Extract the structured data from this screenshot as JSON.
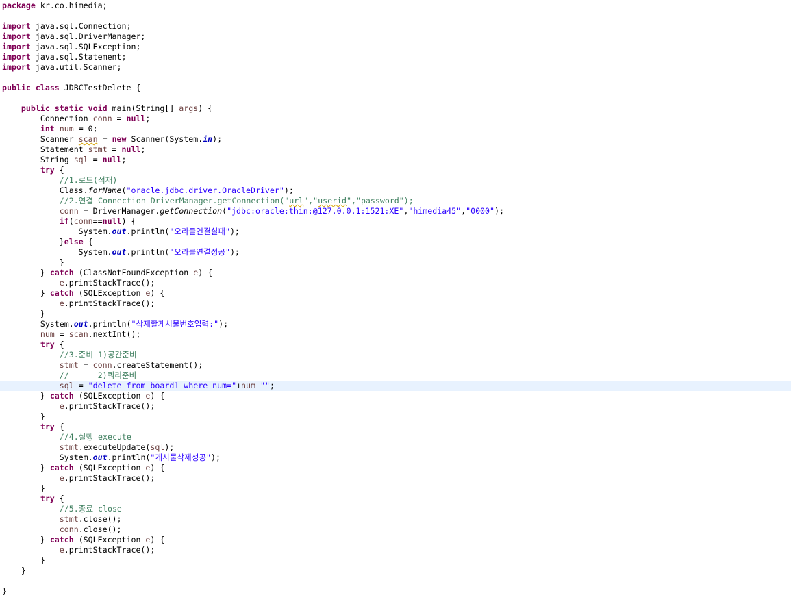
{
  "editor": {
    "language": "java",
    "current_line_index": 37,
    "colors": {
      "keyword": "#7f0055",
      "string": "#2a00ff",
      "comment": "#3f7f5f",
      "local_variable": "#6a3e3e",
      "static_field": "#0000c0",
      "current_line_bg": "#e8f2fe",
      "warning_underline": "#d6a200"
    },
    "lines": [
      [
        {
          "t": "kw",
          "v": "package"
        },
        {
          "t": "p",
          "v": " kr.co.himedia;"
        }
      ],
      [],
      [
        {
          "t": "kw",
          "v": "import"
        },
        {
          "t": "p",
          "v": " java.sql.Connection;"
        }
      ],
      [
        {
          "t": "kw",
          "v": "import"
        },
        {
          "t": "p",
          "v": " java.sql.DriverManager;"
        }
      ],
      [
        {
          "t": "kw",
          "v": "import"
        },
        {
          "t": "p",
          "v": " java.sql.SQLException;"
        }
      ],
      [
        {
          "t": "kw",
          "v": "import"
        },
        {
          "t": "p",
          "v": " java.sql.Statement;"
        }
      ],
      [
        {
          "t": "kw",
          "v": "import"
        },
        {
          "t": "p",
          "v": " java.util.Scanner;"
        }
      ],
      [],
      [
        {
          "t": "kw",
          "v": "public"
        },
        {
          "t": "p",
          "v": " "
        },
        {
          "t": "kw",
          "v": "class"
        },
        {
          "t": "p",
          "v": " JDBCTestDelete {"
        }
      ],
      [],
      [
        {
          "t": "p",
          "v": "    "
        },
        {
          "t": "kw",
          "v": "public"
        },
        {
          "t": "p",
          "v": " "
        },
        {
          "t": "kw",
          "v": "static"
        },
        {
          "t": "p",
          "v": " "
        },
        {
          "t": "kw",
          "v": "void"
        },
        {
          "t": "p",
          "v": " main(String[] "
        },
        {
          "t": "var",
          "v": "args"
        },
        {
          "t": "p",
          "v": ") {"
        }
      ],
      [
        {
          "t": "p",
          "v": "        Connection "
        },
        {
          "t": "var",
          "v": "conn"
        },
        {
          "t": "p",
          "v": " = "
        },
        {
          "t": "kw",
          "v": "null"
        },
        {
          "t": "p",
          "v": ";"
        }
      ],
      [
        {
          "t": "p",
          "v": "        "
        },
        {
          "t": "kw",
          "v": "int"
        },
        {
          "t": "p",
          "v": " "
        },
        {
          "t": "var",
          "v": "num"
        },
        {
          "t": "p",
          "v": " = 0;"
        }
      ],
      [
        {
          "t": "p",
          "v": "        Scanner "
        },
        {
          "t": "varw",
          "v": "scan"
        },
        {
          "t": "p",
          "v": " = "
        },
        {
          "t": "kw",
          "v": "new"
        },
        {
          "t": "p",
          "v": " Scanner(System."
        },
        {
          "t": "static",
          "v": "in"
        },
        {
          "t": "p",
          "v": ");"
        }
      ],
      [
        {
          "t": "p",
          "v": "        Statement "
        },
        {
          "t": "var",
          "v": "stmt"
        },
        {
          "t": "p",
          "v": " = "
        },
        {
          "t": "kw",
          "v": "null"
        },
        {
          "t": "p",
          "v": ";"
        }
      ],
      [
        {
          "t": "p",
          "v": "        String "
        },
        {
          "t": "var",
          "v": "sql"
        },
        {
          "t": "p",
          "v": " = "
        },
        {
          "t": "kw",
          "v": "null"
        },
        {
          "t": "p",
          "v": ";"
        }
      ],
      [
        {
          "t": "p",
          "v": "        "
        },
        {
          "t": "kw",
          "v": "try"
        },
        {
          "t": "p",
          "v": " {"
        }
      ],
      [
        {
          "t": "p",
          "v": "            "
        },
        {
          "t": "com",
          "v": "//1.로드(적재)"
        }
      ],
      [
        {
          "t": "p",
          "v": "            Class."
        },
        {
          "t": "smeth",
          "v": "forName"
        },
        {
          "t": "p",
          "v": "("
        },
        {
          "t": "str",
          "v": "\"oracle.jdbc.driver.OracleDriver\""
        },
        {
          "t": "p",
          "v": ");"
        }
      ],
      [
        {
          "t": "p",
          "v": "            "
        },
        {
          "t": "com",
          "v": "//2.연결 Connection DriverManager.getConnection(\""
        },
        {
          "t": "comw",
          "v": "url"
        },
        {
          "t": "com",
          "v": "\",\""
        },
        {
          "t": "comw",
          "v": "userid"
        },
        {
          "t": "com",
          "v": "\",\"password\");"
        }
      ],
      [
        {
          "t": "p",
          "v": "            "
        },
        {
          "t": "var",
          "v": "conn"
        },
        {
          "t": "p",
          "v": " = DriverManager."
        },
        {
          "t": "smeth",
          "v": "getConnection"
        },
        {
          "t": "p",
          "v": "("
        },
        {
          "t": "str",
          "v": "\"jdbc:oracle:thin:@127.0.0.1:1521:XE\""
        },
        {
          "t": "p",
          "v": ","
        },
        {
          "t": "str",
          "v": "\"himedia45\""
        },
        {
          "t": "p",
          "v": ","
        },
        {
          "t": "str",
          "v": "\"0000\""
        },
        {
          "t": "p",
          "v": ");"
        }
      ],
      [
        {
          "t": "p",
          "v": "            "
        },
        {
          "t": "kw",
          "v": "if"
        },
        {
          "t": "p",
          "v": "("
        },
        {
          "t": "var",
          "v": "conn"
        },
        {
          "t": "p",
          "v": "=="
        },
        {
          "t": "kw",
          "v": "null"
        },
        {
          "t": "p",
          "v": ") {"
        }
      ],
      [
        {
          "t": "p",
          "v": "                System."
        },
        {
          "t": "static",
          "v": "out"
        },
        {
          "t": "p",
          "v": ".println("
        },
        {
          "t": "str",
          "v": "\"오라클연결실패\""
        },
        {
          "t": "p",
          "v": ");"
        }
      ],
      [
        {
          "t": "p",
          "v": "            }"
        },
        {
          "t": "kw",
          "v": "else"
        },
        {
          "t": "p",
          "v": " {"
        }
      ],
      [
        {
          "t": "p",
          "v": "                System."
        },
        {
          "t": "static",
          "v": "out"
        },
        {
          "t": "p",
          "v": ".println("
        },
        {
          "t": "str",
          "v": "\"오라클연결성공\""
        },
        {
          "t": "p",
          "v": ");"
        }
      ],
      [
        {
          "t": "p",
          "v": "            }"
        }
      ],
      [
        {
          "t": "p",
          "v": "        } "
        },
        {
          "t": "kw",
          "v": "catch"
        },
        {
          "t": "p",
          "v": " (ClassNotFoundException "
        },
        {
          "t": "var",
          "v": "e"
        },
        {
          "t": "p",
          "v": ") {"
        }
      ],
      [
        {
          "t": "p",
          "v": "            "
        },
        {
          "t": "var",
          "v": "e"
        },
        {
          "t": "p",
          "v": ".printStackTrace();"
        }
      ],
      [
        {
          "t": "p",
          "v": "        } "
        },
        {
          "t": "kw",
          "v": "catch"
        },
        {
          "t": "p",
          "v": " (SQLException "
        },
        {
          "t": "var",
          "v": "e"
        },
        {
          "t": "p",
          "v": ") {"
        }
      ],
      [
        {
          "t": "p",
          "v": "            "
        },
        {
          "t": "var",
          "v": "e"
        },
        {
          "t": "p",
          "v": ".printStackTrace();"
        }
      ],
      [
        {
          "t": "p",
          "v": "        }"
        }
      ],
      [
        {
          "t": "p",
          "v": "        System."
        },
        {
          "t": "static",
          "v": "out"
        },
        {
          "t": "p",
          "v": ".println("
        },
        {
          "t": "str",
          "v": "\"삭제할게시물번호입력:\""
        },
        {
          "t": "p",
          "v": ");"
        }
      ],
      [
        {
          "t": "p",
          "v": "        "
        },
        {
          "t": "var",
          "v": "num"
        },
        {
          "t": "p",
          "v": " = "
        },
        {
          "t": "var",
          "v": "scan"
        },
        {
          "t": "p",
          "v": ".nextInt();"
        }
      ],
      [
        {
          "t": "p",
          "v": "        "
        },
        {
          "t": "kw",
          "v": "try"
        },
        {
          "t": "p",
          "v": " {"
        }
      ],
      [
        {
          "t": "p",
          "v": "            "
        },
        {
          "t": "com",
          "v": "//3.준비 1)공간준비"
        }
      ],
      [
        {
          "t": "p",
          "v": "            "
        },
        {
          "t": "var",
          "v": "stmt"
        },
        {
          "t": "p",
          "v": " = "
        },
        {
          "t": "var",
          "v": "conn"
        },
        {
          "t": "p",
          "v": ".createStatement();"
        }
      ],
      [
        {
          "t": "p",
          "v": "            "
        },
        {
          "t": "com",
          "v": "//      2)쿼리준비"
        }
      ],
      [
        {
          "t": "p",
          "v": "            "
        },
        {
          "t": "var",
          "v": "sql"
        },
        {
          "t": "p",
          "v": " = "
        },
        {
          "t": "str",
          "v": "\"delete from board1 where num=\""
        },
        {
          "t": "p",
          "v": "+"
        },
        {
          "t": "var",
          "v": "num"
        },
        {
          "t": "p",
          "v": "+"
        },
        {
          "t": "str",
          "v": "\"\""
        },
        {
          "t": "p",
          "v": ";"
        }
      ],
      [
        {
          "t": "p",
          "v": "        } "
        },
        {
          "t": "kw",
          "v": "catch"
        },
        {
          "t": "p",
          "v": " (SQLException "
        },
        {
          "t": "var",
          "v": "e"
        },
        {
          "t": "p",
          "v": ") {"
        }
      ],
      [
        {
          "t": "p",
          "v": "            "
        },
        {
          "t": "var",
          "v": "e"
        },
        {
          "t": "p",
          "v": ".printStackTrace();"
        }
      ],
      [
        {
          "t": "p",
          "v": "        }"
        }
      ],
      [
        {
          "t": "p",
          "v": "        "
        },
        {
          "t": "kw",
          "v": "try"
        },
        {
          "t": "p",
          "v": " {"
        }
      ],
      [
        {
          "t": "p",
          "v": "            "
        },
        {
          "t": "com",
          "v": "//4.실행 execute"
        }
      ],
      [
        {
          "t": "p",
          "v": "            "
        },
        {
          "t": "var",
          "v": "stmt"
        },
        {
          "t": "p",
          "v": ".executeUpdate("
        },
        {
          "t": "var",
          "v": "sql"
        },
        {
          "t": "p",
          "v": ");"
        }
      ],
      [
        {
          "t": "p",
          "v": "            System."
        },
        {
          "t": "static",
          "v": "out"
        },
        {
          "t": "p",
          "v": ".println("
        },
        {
          "t": "str",
          "v": "\"게시물삭제성공\""
        },
        {
          "t": "p",
          "v": ");"
        }
      ],
      [
        {
          "t": "p",
          "v": "        } "
        },
        {
          "t": "kw",
          "v": "catch"
        },
        {
          "t": "p",
          "v": " (SQLException "
        },
        {
          "t": "var",
          "v": "e"
        },
        {
          "t": "p",
          "v": ") {"
        }
      ],
      [
        {
          "t": "p",
          "v": "            "
        },
        {
          "t": "var",
          "v": "e"
        },
        {
          "t": "p",
          "v": ".printStackTrace();"
        }
      ],
      [
        {
          "t": "p",
          "v": "        }"
        }
      ],
      [
        {
          "t": "p",
          "v": "        "
        },
        {
          "t": "kw",
          "v": "try"
        },
        {
          "t": "p",
          "v": " {"
        }
      ],
      [
        {
          "t": "p",
          "v": "            "
        },
        {
          "t": "com",
          "v": "//5.종료 close"
        }
      ],
      [
        {
          "t": "p",
          "v": "            "
        },
        {
          "t": "var",
          "v": "stmt"
        },
        {
          "t": "p",
          "v": ".close();"
        }
      ],
      [
        {
          "t": "p",
          "v": "            "
        },
        {
          "t": "var",
          "v": "conn"
        },
        {
          "t": "p",
          "v": ".close();"
        }
      ],
      [
        {
          "t": "p",
          "v": "        } "
        },
        {
          "t": "kw",
          "v": "catch"
        },
        {
          "t": "p",
          "v": " (SQLException "
        },
        {
          "t": "var",
          "v": "e"
        },
        {
          "t": "p",
          "v": ") {"
        }
      ],
      [
        {
          "t": "p",
          "v": "            "
        },
        {
          "t": "var",
          "v": "e"
        },
        {
          "t": "p",
          "v": ".printStackTrace();"
        }
      ],
      [
        {
          "t": "p",
          "v": "        }"
        }
      ],
      [
        {
          "t": "p",
          "v": "    }"
        }
      ],
      [],
      [
        {
          "t": "p",
          "v": "}"
        }
      ]
    ]
  }
}
